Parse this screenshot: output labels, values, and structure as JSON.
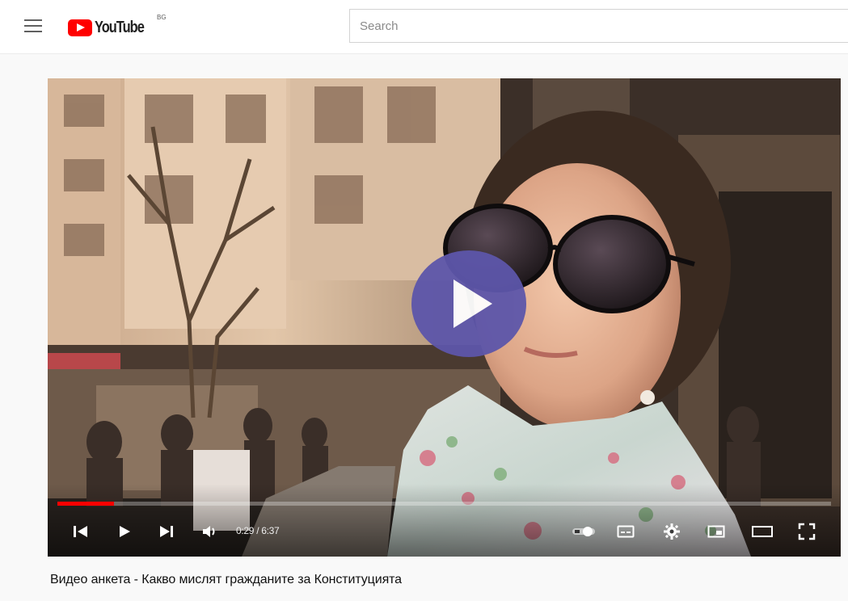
{
  "header": {
    "logo_text": "YouTube",
    "country_code": "BG",
    "search_placeholder": "Search",
    "search_value": ""
  },
  "player": {
    "current_time": "0:29",
    "duration": "6:37",
    "time_separator": " / ",
    "progress_fraction": 0.073,
    "progress_color": "#ff0000",
    "play_button_color": "#5d56aa",
    "controls": {
      "previous": "previous-icon",
      "play": "play-icon",
      "next": "next-icon",
      "volume": "volume-icon",
      "autoplay": "autoplay-toggle-icon",
      "subtitles": "subtitles-icon",
      "settings": "gear-icon",
      "miniplayer": "miniplayer-icon",
      "theater": "theater-mode-icon",
      "fullscreen": "fullscreen-icon"
    }
  },
  "video": {
    "title": "Видео анкета - Какво мислят гражданите за Конституцията"
  }
}
